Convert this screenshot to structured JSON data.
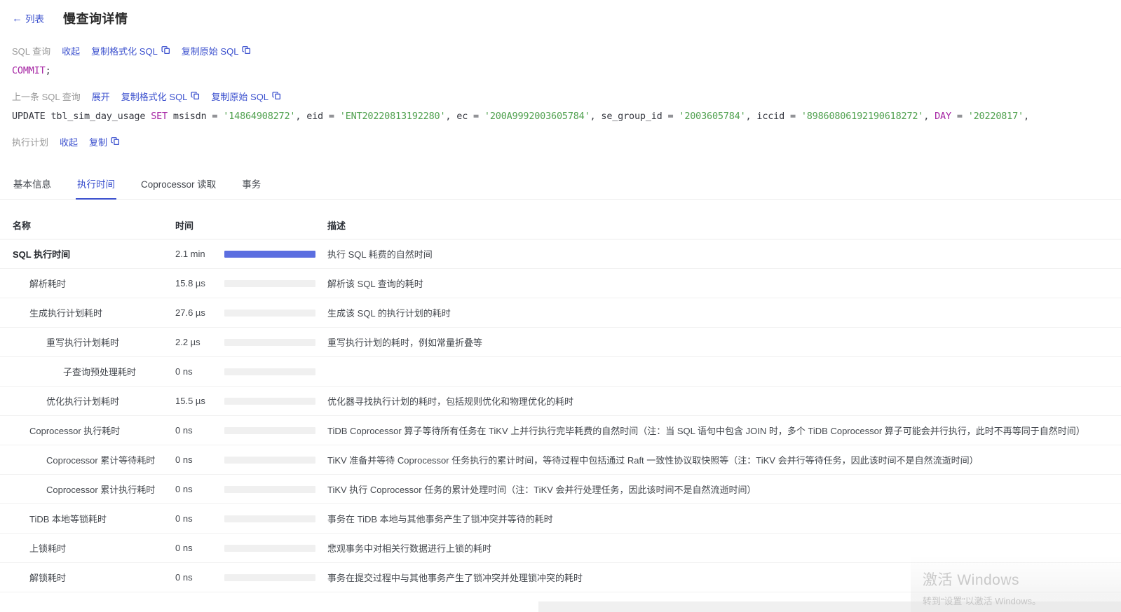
{
  "colors": {
    "accent": "#3b50ce",
    "bar_fill": "#5b6ee0",
    "bar_track": "#f0f0f0",
    "sql_keyword": "#a626a4",
    "sql_string": "#50a14f",
    "sql_plain": "#383a42"
  },
  "header": {
    "back_label": "列表",
    "title": "慢查询详情"
  },
  "sql_section": {
    "label": "SQL 查询",
    "toggle_label": "收起",
    "copy_formatted_label": "复制格式化 SQL",
    "copy_raw_label": "复制原始 SQL",
    "tokens": [
      {
        "t": "COMMIT",
        "c": "kw"
      },
      {
        "t": ";",
        "c": "plain"
      }
    ]
  },
  "prev_sql_section": {
    "label": "上一条 SQL 查询",
    "toggle_label": "展开",
    "copy_formatted_label": "复制格式化 SQL",
    "copy_raw_label": "复制原始 SQL",
    "tokens": [
      {
        "t": "UPDATE tbl_sim_day_usage ",
        "c": "plain"
      },
      {
        "t": "SET",
        "c": "kw"
      },
      {
        "t": " msisdn = ",
        "c": "plain"
      },
      {
        "t": "'14864908272'",
        "c": "str"
      },
      {
        "t": ", eid = ",
        "c": "plain"
      },
      {
        "t": "'ENT20220813192280'",
        "c": "str"
      },
      {
        "t": ", ec = ",
        "c": "plain"
      },
      {
        "t": "'200A9992003605784'",
        "c": "str"
      },
      {
        "t": ", se_group_id = ",
        "c": "plain"
      },
      {
        "t": "'2003605784'",
        "c": "str"
      },
      {
        "t": ", iccid = ",
        "c": "plain"
      },
      {
        "t": "'89860806192190618272'",
        "c": "str"
      },
      {
        "t": ", ",
        "c": "plain"
      },
      {
        "t": "DAY",
        "c": "kw"
      },
      {
        "t": " = ",
        "c": "plain"
      },
      {
        "t": "'20220817'",
        "c": "str"
      },
      {
        "t": ",",
        "c": "plain"
      }
    ]
  },
  "plan_section": {
    "label": "执行计划",
    "toggle_label": "收起",
    "copy_label": "复制"
  },
  "tabs": [
    {
      "label": "基本信息",
      "active": false
    },
    {
      "label": "执行时间",
      "active": true
    },
    {
      "label": "Coprocessor 读取",
      "active": false
    },
    {
      "label": "事务",
      "active": false
    }
  ],
  "table": {
    "columns": [
      "名称",
      "时间",
      "描述"
    ],
    "rows": [
      {
        "name": "SQL 执行时间",
        "indent": 0,
        "bold": true,
        "time": "2.1 min",
        "bar_pct": 100,
        "desc": "执行 SQL 耗费的自然时间"
      },
      {
        "name": "解析耗时",
        "indent": 1,
        "bold": false,
        "time": "15.8 µs",
        "bar_pct": 0,
        "desc": "解析该 SQL 查询的耗时"
      },
      {
        "name": "生成执行计划耗时",
        "indent": 1,
        "bold": false,
        "time": "27.6 µs",
        "bar_pct": 0,
        "desc": "生成该 SQL 的执行计划的耗时"
      },
      {
        "name": "重写执行计划耗时",
        "indent": 2,
        "bold": false,
        "time": "2.2 µs",
        "bar_pct": 0,
        "desc": "重写执行计划的耗时，例如常量折叠等"
      },
      {
        "name": "子查询预处理耗时",
        "indent": 3,
        "bold": false,
        "time": "0 ns",
        "bar_pct": 0,
        "desc": ""
      },
      {
        "name": "优化执行计划耗时",
        "indent": 2,
        "bold": false,
        "time": "15.5 µs",
        "bar_pct": 0,
        "desc": "优化器寻找执行计划的耗时，包括规则优化和物理优化的耗时"
      },
      {
        "name": "Coprocessor 执行耗时",
        "indent": 1,
        "bold": false,
        "time": "0 ns",
        "bar_pct": 0,
        "desc": "TiDB Coprocessor 算子等待所有任务在 TiKV 上并行执行完毕耗费的自然时间（注：当 SQL 语句中包含 JOIN 时，多个 TiDB Coprocessor 算子可能会并行执行，此时不再等同于自然时间）"
      },
      {
        "name": "Coprocessor 累计等待耗时",
        "indent": 2,
        "bold": false,
        "time": "0 ns",
        "bar_pct": 0,
        "desc": "TiKV 准备并等待 Coprocessor 任务执行的累计时间，等待过程中包括通过 Raft 一致性协议取快照等（注：TiKV 会并行等待任务，因此该时间不是自然流逝时间）"
      },
      {
        "name": "Coprocessor 累计执行耗时",
        "indent": 2,
        "bold": false,
        "time": "0 ns",
        "bar_pct": 0,
        "desc": "TiKV 执行 Coprocessor 任务的累计处理时间（注：TiKV 会并行处理任务，因此该时间不是自然流逝时间）"
      },
      {
        "name": "TiDB 本地等锁耗时",
        "indent": 1,
        "bold": false,
        "time": "0 ns",
        "bar_pct": 0,
        "desc": "事务在 TiDB 本地与其他事务产生了锁冲突并等待的耗时"
      },
      {
        "name": "上锁耗时",
        "indent": 1,
        "bold": false,
        "time": "0 ns",
        "bar_pct": 0,
        "desc": "悲观事务中对相关行数据进行上锁的耗时"
      },
      {
        "name": "解锁耗时",
        "indent": 1,
        "bold": false,
        "time": "0 ns",
        "bar_pct": 0,
        "desc": "事务在提交过程中与其他事务产生了锁冲突并处理锁冲突的耗时"
      }
    ]
  },
  "watermark": {
    "line1": "激活 Windows",
    "line2": "转到“设置”以激活 Windows。"
  }
}
